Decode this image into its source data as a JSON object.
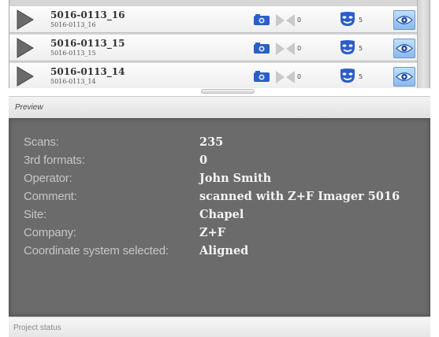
{
  "scans": [
    {
      "name": "5016-0113_16",
      "subname": "5016-0113_16",
      "bowtie_count": "0",
      "mask_count": "5"
    },
    {
      "name": "5016-0113_15",
      "subname": "5016-0113_15",
      "bowtie_count": "0",
      "mask_count": "5"
    },
    {
      "name": "5016-0113_14",
      "subname": "5016-0113_14",
      "bowtie_count": "0",
      "mask_count": "5"
    }
  ],
  "preview": {
    "title": "Preview",
    "fields": [
      {
        "label": "Scans:",
        "value": "235"
      },
      {
        "label": "3rd formats:",
        "value": "0"
      },
      {
        "label": "Operator:",
        "value": "John Smith"
      },
      {
        "label": "Comment:",
        "value": "scanned with Z+F Imager 5016"
      },
      {
        "label": "Site:",
        "value": "Chapel"
      },
      {
        "label": "Company:",
        "value": "Z+F"
      },
      {
        "label": "Coordinate system selected:",
        "value": "Aligned"
      }
    ]
  },
  "status": {
    "title": "Project status"
  },
  "icons": {
    "row_play": "play-triangle-icon",
    "camera": "camera-icon",
    "bowtie": "bowtie-icon",
    "mask": "mask-icon",
    "view": "eye-icon"
  },
  "colors": {
    "preview_background": "#6b6b6b",
    "label_text": "#c6c6c6",
    "value_text": "#f4f4f4",
    "accent_blue": "#2c5ec7",
    "view_button": "#a6ccf5"
  }
}
